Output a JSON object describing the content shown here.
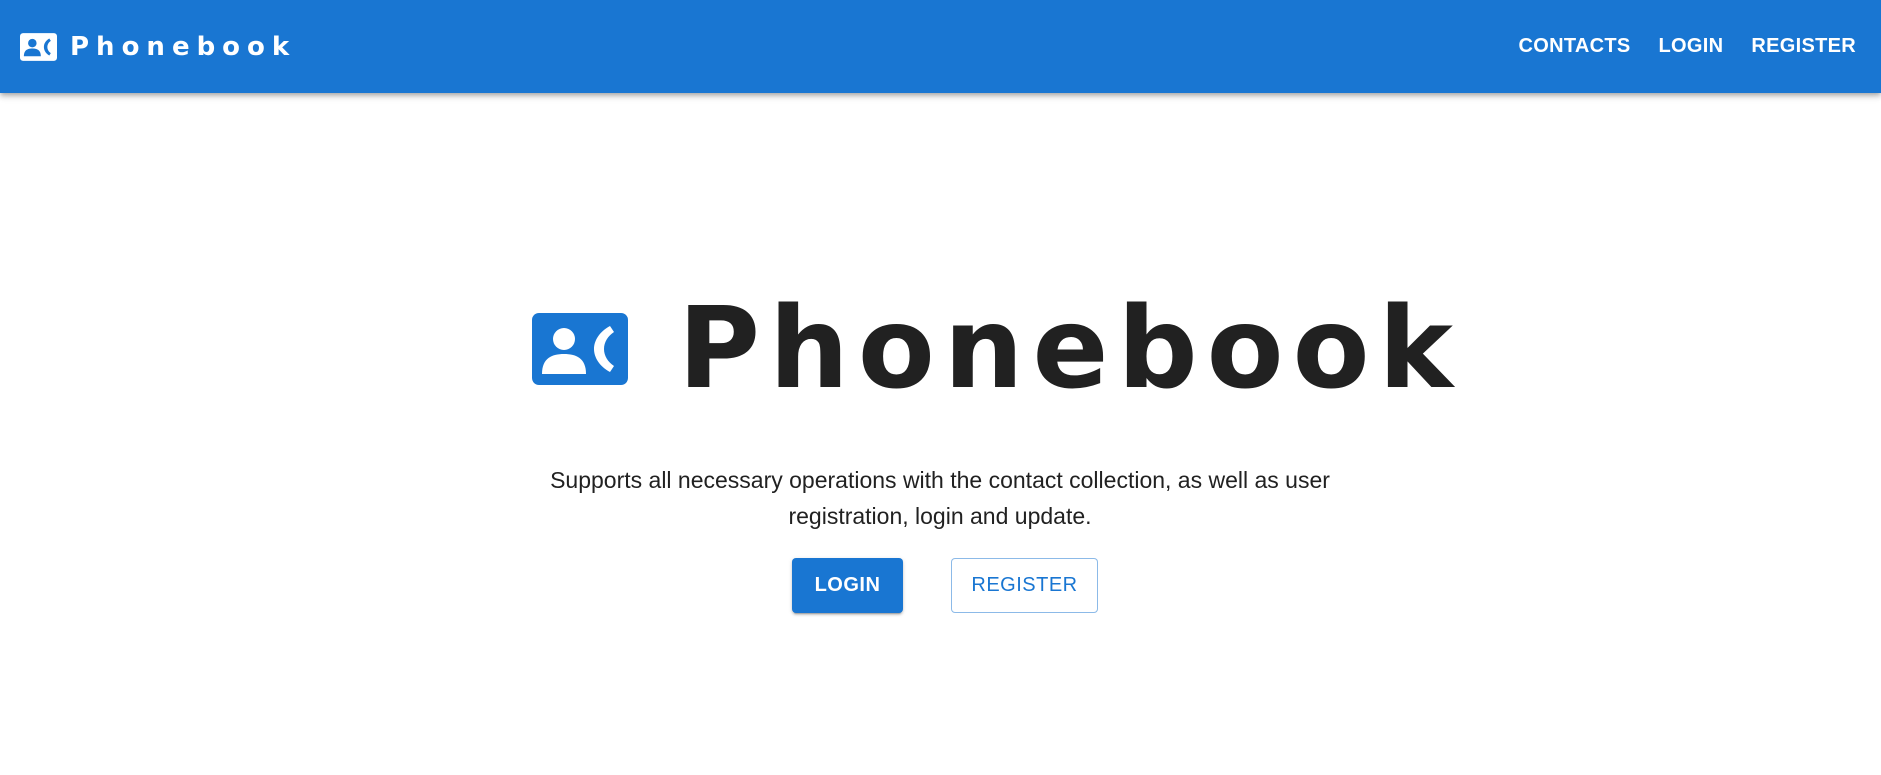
{
  "appbar": {
    "brand_name": "Phonebook",
    "brand_icon": "contact-phone-icon",
    "nav": [
      {
        "label": "CONTACTS"
      },
      {
        "label": "LOGIN"
      },
      {
        "label": "REGISTER"
      }
    ]
  },
  "hero": {
    "title": "Phonebook",
    "title_icon": "contact-phone-icon",
    "description": "Supports all necessary operations with the contact collection, as well as user registration, login and update.",
    "login_label": "LOGIN",
    "register_label": "REGISTER"
  },
  "colors": {
    "primary": "#1976d2",
    "text": "#212121",
    "background": "#ffffff"
  }
}
